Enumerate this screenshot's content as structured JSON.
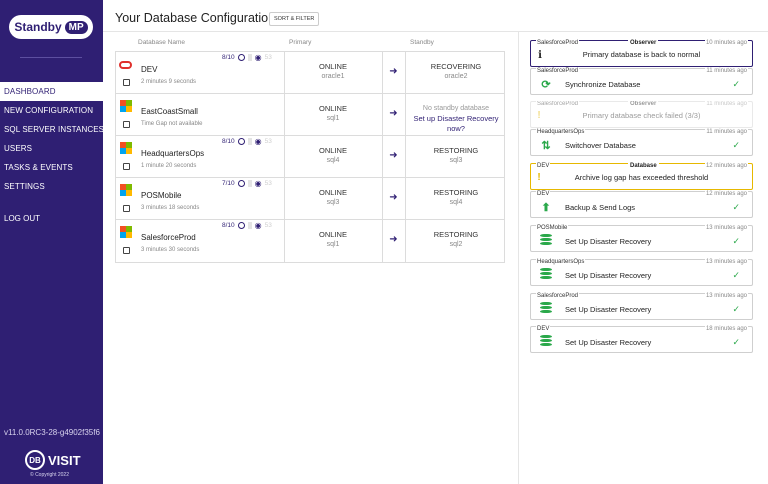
{
  "sidebar": {
    "logo_text": "Standby",
    "logo_badge": "MP",
    "nav": [
      "DASHBOARD",
      "NEW CONFIGURATION",
      "SQL SERVER INSTANCES",
      "USERS",
      "TASKS & EVENTS",
      "SETTINGS"
    ],
    "active_index": 0,
    "logout": "LOG OUT",
    "version": "v11.0.0RC3-28-g4902f35f6",
    "brand_mark": "DB",
    "brand_name": "VISIT",
    "copyright": "© Copyright 2022"
  },
  "header": {
    "title": "Your Database Configurations",
    "sort_label": "SORT & FILTER"
  },
  "columns": {
    "name": "Database Name",
    "primary": "Primary",
    "standby": "Standby"
  },
  "configs": [
    {
      "name": "DEV",
      "engine": "oracle",
      "sub": "2 minutes 9 seconds",
      "score": "8/10",
      "tail": "53",
      "primary_status": "ONLINE",
      "primary_host": "oracle1",
      "standby_status": "RECOVERING",
      "standby_host": "oracle2"
    },
    {
      "name": "EastCoastSmall",
      "engine": "mssql",
      "sub": "Time Gap not available",
      "score": "",
      "tail": "",
      "primary_status": "ONLINE",
      "primary_host": "sql1",
      "standby_none": "No standby database",
      "standby_link": "Set up Disaster Recovery now?"
    },
    {
      "name": "HeadquartersOps",
      "engine": "mssql",
      "sub": "1 minute 20 seconds",
      "score": "8/10",
      "tail": "53",
      "primary_status": "ONLINE",
      "primary_host": "sql4",
      "standby_status": "RESTORING",
      "standby_host": "sql3"
    },
    {
      "name": "POSMobile",
      "engine": "mssql",
      "sub": "3 minutes 18 seconds",
      "score": "7/10",
      "tail": "53",
      "primary_status": "ONLINE",
      "primary_host": "sql3",
      "standby_status": "RESTORING",
      "standby_host": "sql4"
    },
    {
      "name": "SalesforceProd",
      "engine": "mssql",
      "sub": "3 minutes 30 seconds",
      "score": "8/10",
      "tail": "53",
      "primary_status": "ONLINE",
      "primary_host": "sql1",
      "standby_status": "RESTORING",
      "standby_host": "sql2"
    }
  ],
  "events": [
    {
      "source": "SalesforceProd",
      "kind": "Observer",
      "time": "10 minutes ago",
      "message": "Primary database is back to normal",
      "icon": "info-icon",
      "style": "obs"
    },
    {
      "source": "SalesforceProd",
      "kind": "",
      "time": "11 minutes ago",
      "message": "Synchronize Database",
      "icon": "sync-icon",
      "style": "task"
    },
    {
      "source": "SalesforceProd",
      "kind": "Observer",
      "time": "11 minutes ago",
      "message": "Primary database check failed (3/3)",
      "icon": "exclamation-icon",
      "style": "faded"
    },
    {
      "source": "HeadquartersOps",
      "kind": "",
      "time": "11 minutes ago",
      "message": "Switchover Database",
      "icon": "switchover-icon",
      "style": "task"
    },
    {
      "source": "DEV",
      "kind": "Database",
      "time": "12 minutes ago",
      "message": "Archive log gap has exceeded threshold",
      "icon": "exclamation-icon",
      "style": "warn"
    },
    {
      "source": "DEV",
      "kind": "",
      "time": "12 minutes ago",
      "message": "Backup & Send Logs",
      "icon": "upload-icon",
      "style": "task"
    },
    {
      "source": "POSMobile",
      "kind": "",
      "time": "13 minutes ago",
      "message": "Set Up Disaster Recovery",
      "icon": "database-icon",
      "style": "task"
    },
    {
      "source": "HeadquartersOps",
      "kind": "",
      "time": "13 minutes ago",
      "message": "Set Up Disaster Recovery",
      "icon": "database-icon",
      "style": "task"
    },
    {
      "source": "SalesforceProd",
      "kind": "",
      "time": "13 minutes ago",
      "message": "Set Up Disaster Recovery",
      "icon": "database-icon",
      "style": "task"
    },
    {
      "source": "DEV",
      "kind": "",
      "time": "18 minutes ago",
      "message": "Set Up Disaster Recovery",
      "icon": "database-icon",
      "style": "task"
    }
  ]
}
